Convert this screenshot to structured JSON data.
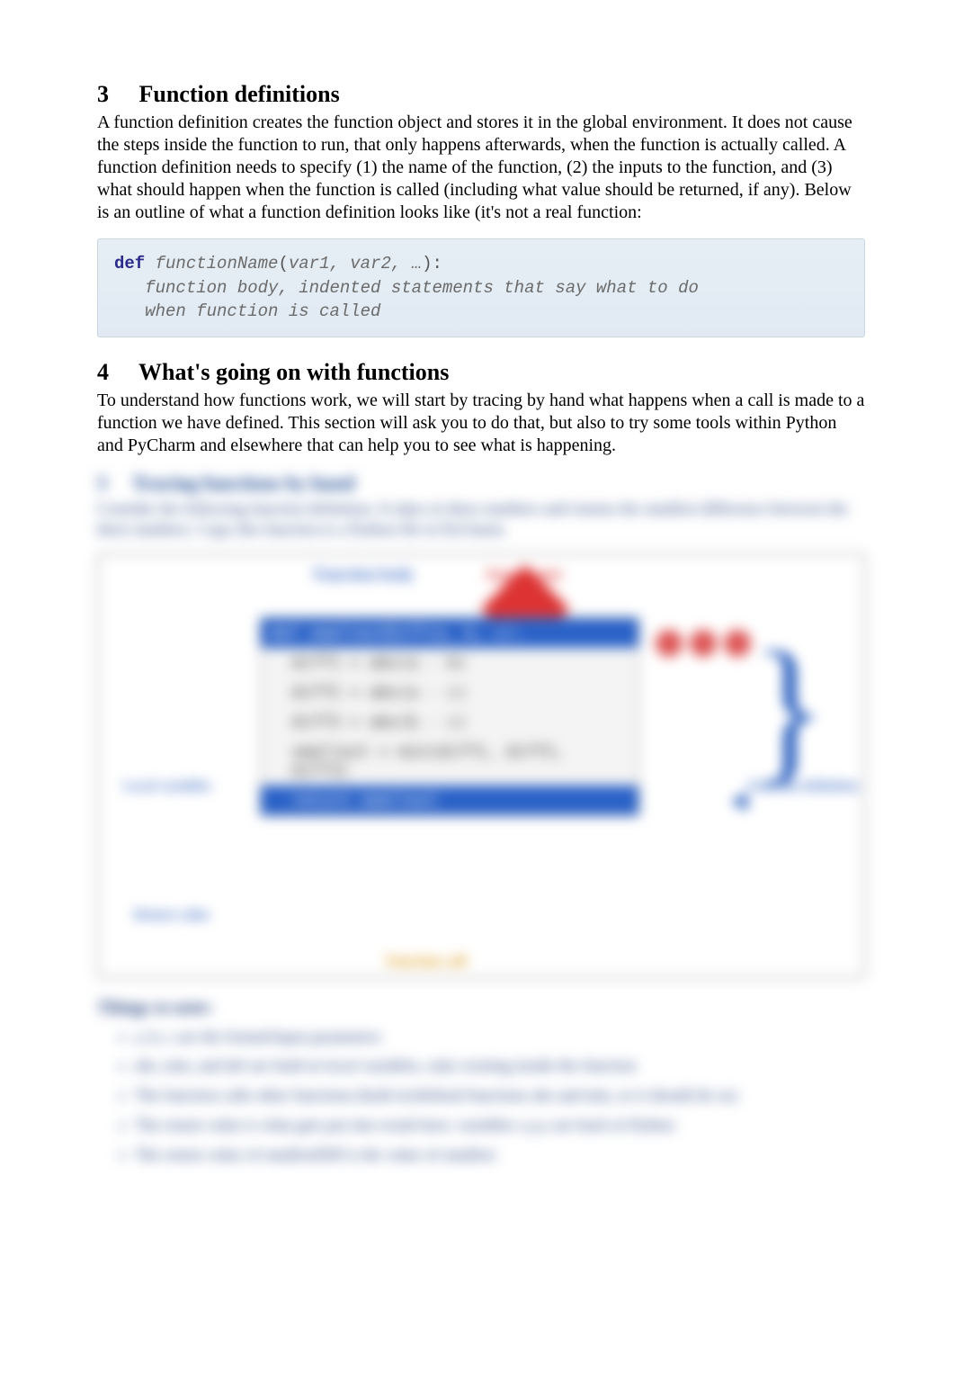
{
  "section3": {
    "number": "3",
    "title": "Function definitions",
    "paragraph": "A function definition creates the function object and stores it in the global environment. It does not cause the steps inside the function to run, that only happens afterwards, when the function is actually called. A function definition needs to specify (1) the name of the function, (2) the inputs to the function, and (3) what should happen when the function is called (including what value should be returned, if any). Below is an outline of what a function definition looks like (it's not a real function:"
  },
  "code": {
    "kw": "def",
    "fnName": "functionName",
    "params": "var1, var2, …",
    "bodyLine1": "function body, indented statements that say what to do",
    "bodyLine2": "when function is called"
  },
  "section4": {
    "number": "4",
    "title": "What's going on with functions",
    "paragraph": "To understand how functions work, we will start by tracing by hand what happens when a call is made to a function we have defined. This section will ask you to do that, but also to try some tools within Python and PyCharm and elsewhere that can help you to see what is happening."
  },
  "blurred": {
    "subNumber": "5",
    "subTitle": "Tracing functions by hand",
    "subPara": "Consider the following function definition. It takes in three numbers and returns the smallest difference between the three numbers. Copy this function to a Python file in PyCharm.",
    "diagram": {
      "topLabel": "Function body",
      "redLabel": "Arguments",
      "fnHeader": "def smallestDiff(a, b, c):",
      "lines": [
        "diff1 = abs(a - b)",
        "diff2 = abs(a - c)",
        "diff3 = abs(b - c)",
        "smallest = min(diff1, diff2, diff3)"
      ],
      "returnLine": "return smallest",
      "leftLabel": "Local variables",
      "rightLabel": "Function definition",
      "callLabel": "Function call",
      "bottomLeft": "Return value"
    },
    "thingsHeading": "Things to note:",
    "bullets": [
      "a, b, c are the formal/input parameters",
      "abs, min, and def are built-in local variables, only existing inside the function",
      "The function calls other functions (built-in/defined functions abs and min, so it should do so)",
      "The return value is what gets put into result here; variables x,y,z are back in Python",
      "The return value of smallestDiff is the value of smallest"
    ]
  }
}
